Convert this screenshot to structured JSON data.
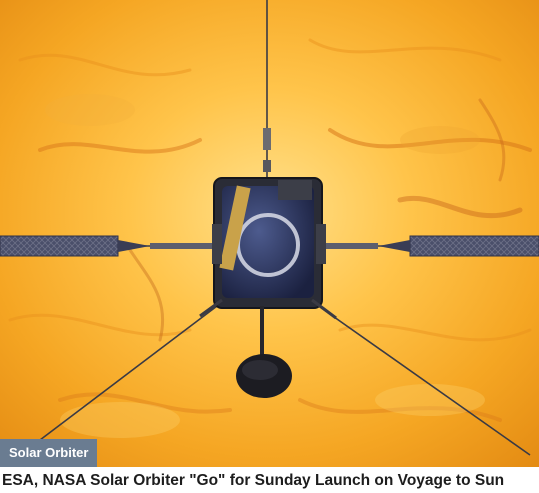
{
  "article": {
    "image_alt": "Solar Orbiter spacecraft in front of the Sun",
    "category_tag": "Solar Orbiter",
    "headline": "ESA, NASA Solar Orbiter \"Go\" for Sunday Launch on Voyage to Sun"
  },
  "colors": {
    "sun_core": "#ffd36a",
    "sun_edge": "#e38a12",
    "tag_bg": "#6a7c91",
    "headline_text": "#1d1d1d"
  }
}
